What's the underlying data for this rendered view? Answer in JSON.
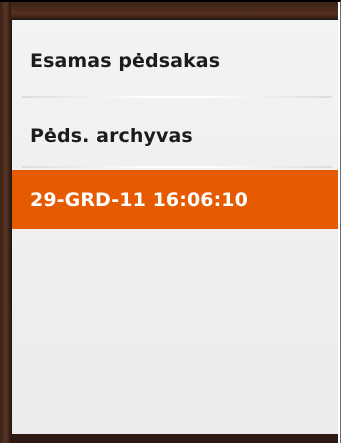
{
  "menu": {
    "items": [
      {
        "label": "Esamas pėdsakas",
        "selected": false
      },
      {
        "label": "Pėds. archyvas",
        "selected": false
      },
      {
        "label": "29-GRD-11 16:06:10",
        "selected": true
      }
    ]
  },
  "colors": {
    "selected_background": "#e65a00",
    "selected_text": "#ffffff",
    "bezel": "#4a2c20",
    "screen_background": "#efefef"
  }
}
